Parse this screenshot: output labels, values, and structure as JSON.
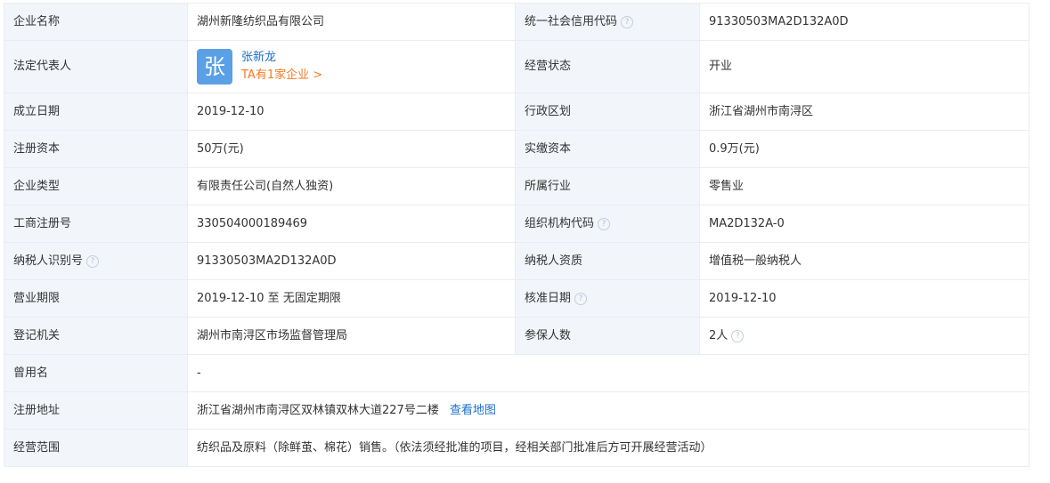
{
  "rows": [
    {
      "l1": "企业名称",
      "v1": "湖州新隆纺织品有限公司",
      "l2": "统一社会信用代码",
      "v2": "91330503MA2D132A0D"
    },
    {
      "l1": "法定代表人",
      "l2": "经营状态",
      "v2": "开业"
    },
    {
      "l1": "成立日期",
      "v1": "2019-12-10",
      "l2": "行政区划",
      "v2": "浙江省湖州市南浔区"
    },
    {
      "l1": "注册资本",
      "v1": "50万(元)",
      "l2": "实缴资本",
      "v2": "0.9万(元)"
    },
    {
      "l1": "企业类型",
      "v1": "有限责任公司(自然人独资)",
      "l2": "所属行业",
      "v2": "零售业"
    },
    {
      "l1": "工商注册号",
      "v1": "330504000189469",
      "l2": "组织机构代码",
      "v2": "MA2D132A-0"
    },
    {
      "l1": "纳税人识别号",
      "v1": "91330503MA2D132A0D",
      "l2": "纳税人资质",
      "v2": "增值税一般纳税人"
    },
    {
      "l1": "营业期限",
      "v1": "2019-12-10 至 无固定期限",
      "l2": "核准日期",
      "v2": "2019-12-10"
    },
    {
      "l1": "登记机关",
      "v1": "湖州市南浔区市场监督管理局",
      "l2": "参保人数",
      "v2": "2人"
    },
    {
      "l1": "曾用名",
      "v1": "-"
    },
    {
      "l1": "注册地址",
      "v1": "浙江省湖州市南浔区双林镇双林大道227号二楼"
    },
    {
      "l1": "经营范围",
      "v1": "纺织品及原料（除鲜茧、棉花）销售。（依法须经批准的项目，经相关部门批准后方可开展经营活动）"
    }
  ],
  "legal_rep": {
    "avatar_char": "张",
    "name": "张新龙",
    "more": "TA有1家企业 >"
  },
  "address_link": "查看地图",
  "help_glyph": "?",
  "colors": {
    "label_bg": "#f2f6fb",
    "border": "#e9edf3",
    "link": "#1a6fc9",
    "orange": "#f47a23",
    "avatar_bg": "#5aa0e6"
  }
}
